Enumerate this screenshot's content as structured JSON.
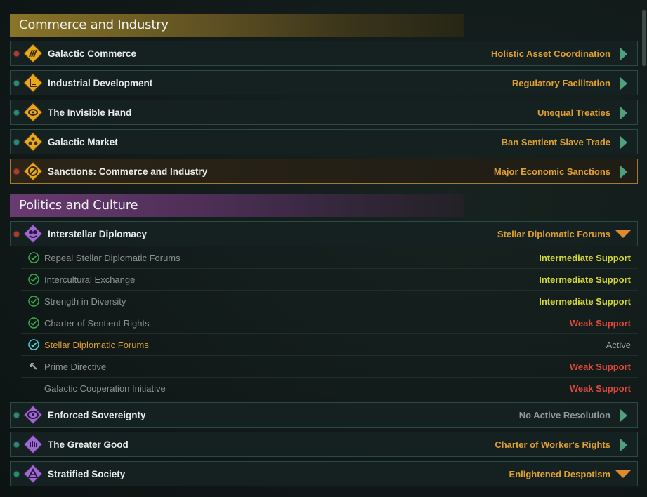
{
  "colors": {
    "status_orange": "#e0a030",
    "support_yellow": "#d6d836",
    "support_red": "#e04a3c",
    "commerce_header": "#8a7428",
    "politics_header": "#6a3a72"
  },
  "categories": {
    "commerce": {
      "title": "Commerce and Industry",
      "items": [
        {
          "title": "Galactic Commerce",
          "status": "Holistic Asset Coordination",
          "dot": "red",
          "icon": "commerce-icon"
        },
        {
          "title": "Industrial Development",
          "status": "Regulatory Facilitation",
          "dot": "green",
          "icon": "industry-icon"
        },
        {
          "title": "The Invisible Hand",
          "status": "Unequal Treaties",
          "dot": "green",
          "icon": "invisible-hand-icon"
        },
        {
          "title": "Galactic Market",
          "status": "Ban Sentient Slave Trade",
          "dot": "green",
          "icon": "market-icon"
        },
        {
          "title": "Sanctions: Commerce and Industry",
          "status": "Major Economic Sanctions",
          "dot": "red",
          "icon": "sanctions-icon"
        }
      ]
    },
    "politics": {
      "title": "Politics and Culture",
      "expanded": {
        "title": "Interstellar Diplomacy",
        "status": "Stellar Diplomatic Forums",
        "dot": "red",
        "icon": "diplomacy-icon",
        "resolutions": [
          {
            "title": "Repeal Stellar Diplomatic Forums",
            "support": "Intermediate Support",
            "icon": "check-icon"
          },
          {
            "title": "Intercultural Exchange",
            "support": "Intermediate Support",
            "icon": "check-icon"
          },
          {
            "title": "Strength in Diversity",
            "support": "Intermediate Support",
            "icon": "check-icon"
          },
          {
            "title": "Charter of Sentient Rights",
            "support": "Weak Support",
            "icon": "check-icon"
          },
          {
            "title": "Stellar Diplomatic Forums",
            "support": "Active",
            "icon": "check-active-icon"
          },
          {
            "title": "Prime Directive",
            "support": "Weak Support",
            "icon": "revert-icon"
          },
          {
            "title": "Galactic Cooperation Initiative",
            "support": "Weak Support",
            "icon": ""
          }
        ]
      },
      "items": [
        {
          "title": "Enforced Sovereignty",
          "status": "No Active Resolution",
          "dot": "green",
          "icon": "sovereignty-icon"
        },
        {
          "title": "The Greater Good",
          "status": "Charter of Worker's Rights",
          "dot": "green",
          "icon": "greater-good-icon"
        },
        {
          "title": "Stratified Society",
          "status": "Enlightened Despotism",
          "dot": "green",
          "icon": "stratified-icon"
        }
      ]
    }
  }
}
